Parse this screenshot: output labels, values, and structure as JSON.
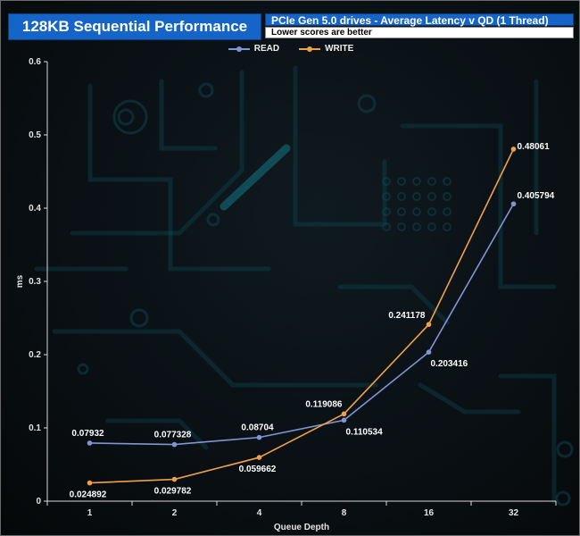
{
  "header": {
    "title": "128KB Sequential Performance",
    "subtitle": "PCIe Gen 5.0 drives - Average Latency v QD (1 Thread)",
    "note": "Lower scores are better"
  },
  "colors": {
    "read": "#8094d6",
    "write": "#f0a04a",
    "header_blue": "#1565c8",
    "decor": "#0e4c58"
  },
  "chart_data": {
    "type": "line",
    "categories": [
      "1",
      "2",
      "4",
      "8",
      "16",
      "32"
    ],
    "series": [
      {
        "name": "READ",
        "values": [
          0.07932,
          0.077328,
          0.08704,
          0.110534,
          0.203416,
          0.405794
        ],
        "labels": [
          "0.07932",
          "0.077328",
          "0.08704",
          "0.110534",
          "0.203416",
          "0.405794"
        ]
      },
      {
        "name": "WRITE",
        "values": [
          0.024892,
          0.029782,
          0.059662,
          0.119086,
          0.241178,
          0.48061
        ],
        "labels": [
          "0.024892",
          "0.029782",
          "0.059662",
          "0.119086",
          "0.241178",
          "0.48061"
        ]
      }
    ],
    "xlabel": "Queue Depth",
    "ylabel": "ms",
    "ylim": [
      0,
      0.6
    ],
    "yticks": [
      "0",
      "0.1",
      "0.2",
      "0.3",
      "0.4",
      "0.5",
      "0.6"
    ],
    "legend": "top-center",
    "grid": false
  }
}
